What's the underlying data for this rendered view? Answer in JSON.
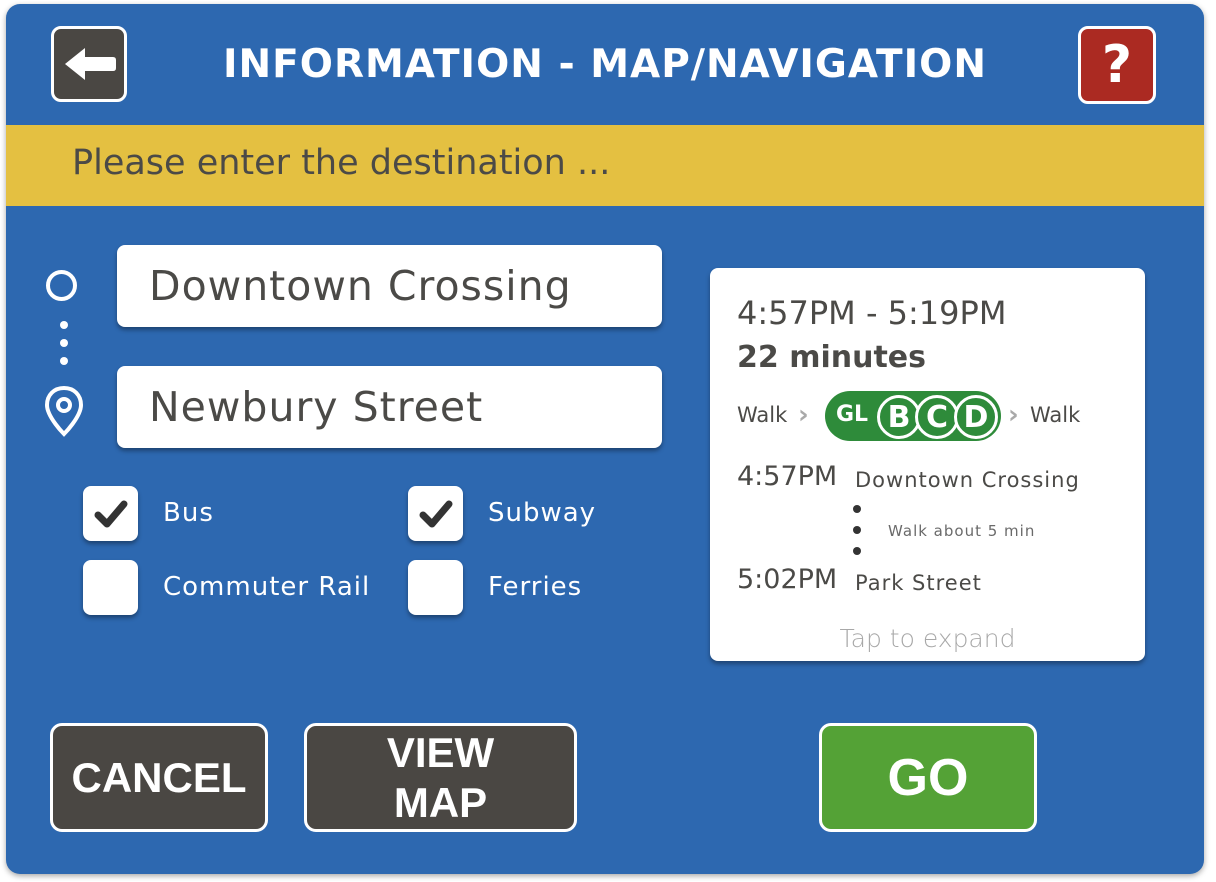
{
  "header": {
    "title": "INFORMATION - MAP/NAVIGATION",
    "back_icon": "arrow-left-icon",
    "help_label": "?"
  },
  "banner": {
    "prompt": "Please enter the destination ..."
  },
  "route": {
    "origin": "Downtown Crossing",
    "destination": "Newbury Street"
  },
  "modes": [
    {
      "label": "Bus",
      "checked": true
    },
    {
      "label": "Subway",
      "checked": true
    },
    {
      "label": "Commuter Rail",
      "checked": false
    },
    {
      "label": "Ferries",
      "checked": false
    }
  ],
  "trip": {
    "time_range": "4:57PM - 5:19PM",
    "duration": "22 minutes",
    "walk_before": "Walk",
    "line": "GL",
    "branches": [
      "B",
      "C",
      "D"
    ],
    "walk_after": "Walk",
    "line_color": "#2e8b3a",
    "steps": [
      {
        "time": "4:57PM",
        "stop": "Downtown Crossing"
      },
      {
        "time": "5:02PM",
        "stop": "Park Street"
      }
    ],
    "walk_note": "Walk about 5 min",
    "expand_hint": "Tap to expand"
  },
  "actions": {
    "cancel": "CANCEL",
    "view_map_line1": "VIEW",
    "view_map_line2": "MAP",
    "go": "GO"
  },
  "colors": {
    "background": "#2d68b0",
    "banner": "#e4c041",
    "help": "#ab2a22",
    "go": "#54a236",
    "dark_button": "#4a4743"
  }
}
